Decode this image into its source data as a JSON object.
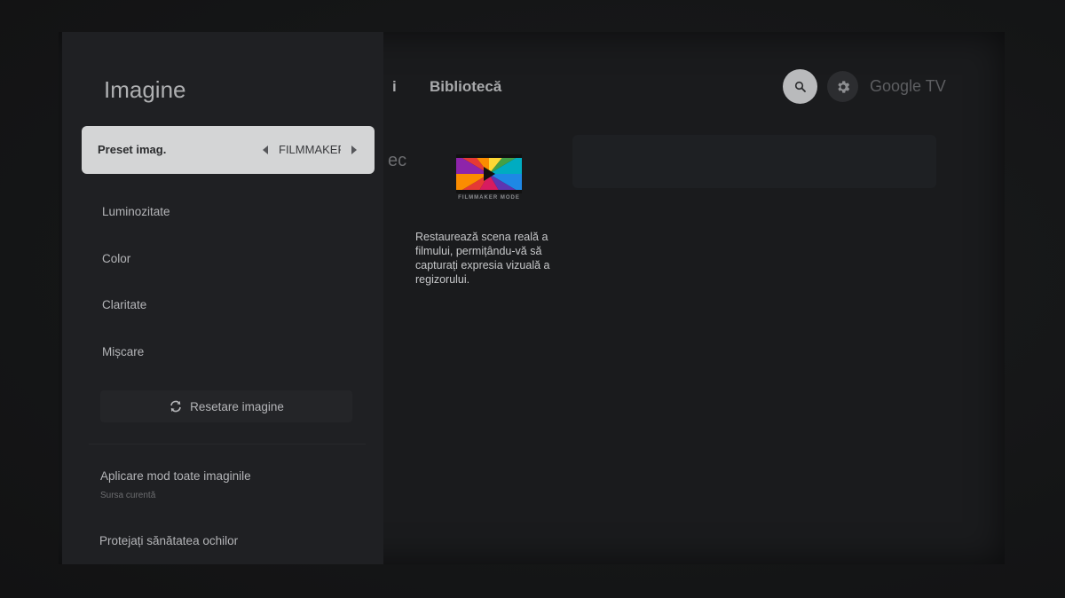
{
  "background": {
    "tabs": [
      {
        "label": "i"
      },
      {
        "label": "Bibliotecă"
      }
    ],
    "partial_text": "ec",
    "brand": "Google TV",
    "icons": {
      "search": "search-icon",
      "settings": "gear-icon"
    }
  },
  "info_card": {
    "logo_text": "FILMMAKER MODE",
    "description": "Restaurează scena reală a filmului, permițându-vă să capturați expresia vizuală a regizorului."
  },
  "panel": {
    "title": "Imagine",
    "preset": {
      "label": "Preset imag.",
      "value": "FILMMAKER"
    },
    "items": [
      {
        "label": "Luminozitate"
      },
      {
        "label": "Color"
      },
      {
        "label": "Claritate"
      },
      {
        "label": "Mișcare"
      }
    ],
    "reset_label": "Resetare imagine",
    "apply": {
      "title": "Aplicare mod toate imaginile",
      "subtitle": "Sursa curentă"
    },
    "eye_protection": "Protejați sănătatea ochilor"
  },
  "colors": {
    "focus_highlight": "#d4d5d6",
    "panel_bg": "#1f2023"
  }
}
